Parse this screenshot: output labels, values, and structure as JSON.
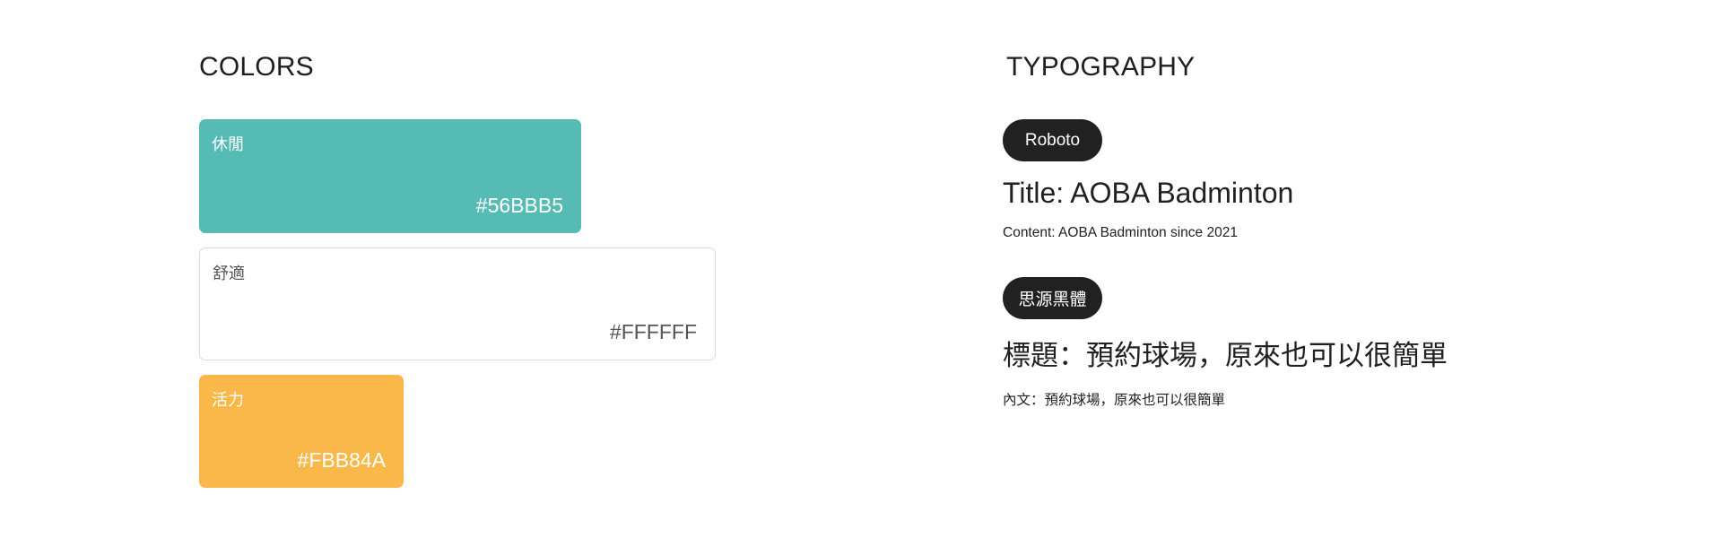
{
  "colors": {
    "heading": "COLORS",
    "swatches": [
      {
        "name": "休閒",
        "hex": "#56BBB5",
        "color": "#56BBB5",
        "text_color": "#FFFFFF"
      },
      {
        "name": "舒適",
        "hex": "#FFFFFF",
        "color": "#FFFFFF",
        "text_color": "#555555"
      },
      {
        "name": "活力",
        "hex": "#FBB84A",
        "color": "#FBB84A",
        "text_color": "#FFFFFF"
      }
    ]
  },
  "typography": {
    "heading": "TYPOGRAPHY",
    "fonts": [
      {
        "label": "Roboto",
        "title": "Title: AOBA Badminton",
        "content": "Content: AOBA Badminton since 2021"
      },
      {
        "label": "思源黑體",
        "title": "標題：預約球場，原來也可以很簡單",
        "content": "內文：預約球場，原來也可以很簡單"
      }
    ]
  }
}
